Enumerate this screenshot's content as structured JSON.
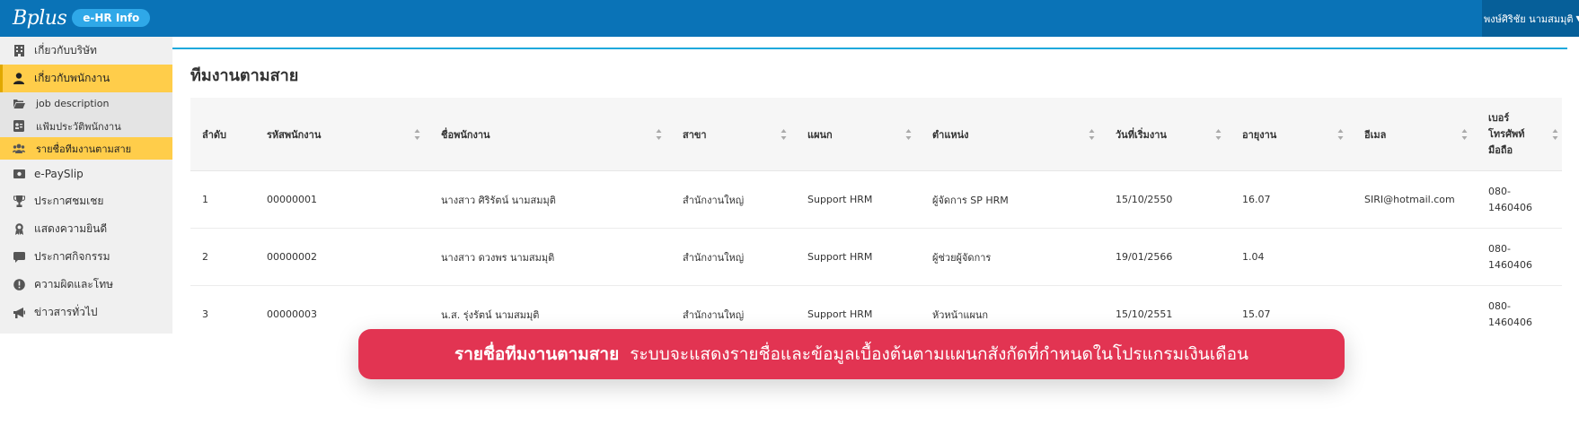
{
  "header": {
    "logo_text": "Bplus",
    "badge": "e-HR Info",
    "user_name": "พงษ์ศิริชัย นามสมมุติ"
  },
  "sidebar": {
    "items": [
      {
        "label": "เกี่ยวกับบริษัท",
        "icon": "building-icon"
      },
      {
        "label": "เกี่ยวกับพนักงาน",
        "icon": "user-icon",
        "active": true
      },
      {
        "label": "job description",
        "icon": "folder-open-icon",
        "sub": true
      },
      {
        "label": "แฟ้มประวัติพนักงาน",
        "icon": "id-card-icon",
        "sub": true
      },
      {
        "label": "รายชื่อทีมงานตามสาย",
        "icon": "users-icon",
        "sub": true,
        "active": true
      },
      {
        "label": "e-PaySlip",
        "icon": "money-icon"
      },
      {
        "label": "ประกาศชมเชย",
        "icon": "trophy-icon"
      },
      {
        "label": "แสดงความยินดี",
        "icon": "award-icon"
      },
      {
        "label": "ประกาศกิจกรรม",
        "icon": "comment-icon"
      },
      {
        "label": "ความผิดและโทษ",
        "icon": "exclamation-circle-icon"
      },
      {
        "label": "ข่าวสารทั่วไป",
        "icon": "megaphone-icon"
      }
    ]
  },
  "main": {
    "title": "ทีมงานตามสาย",
    "table": {
      "columns": [
        "ลำดับ",
        "รหัสพนักงาน",
        "ชื่อพนักงาน",
        "สาขา",
        "แผนก",
        "ตำแหน่ง",
        "วันที่เริ่มงาน",
        "อายุงาน",
        "อีเมล",
        "เบอร์\nโทรศัพท์\nมือถือ"
      ],
      "rows": [
        [
          "1",
          "00000001",
          "นางสาว ศิริรัตน์ นามสมมุติ",
          "สำนักงานใหญ่",
          "Support HRM",
          "ผู้จัดการ SP HRM",
          "15/10/2550",
          "16.07",
          "SIRI@hotmail.com",
          "080-\n1460406"
        ],
        [
          "2",
          "00000002",
          "นางสาว ดวงพร นามสมมุติ",
          "สำนักงานใหญ่",
          "Support HRM",
          "ผู้ช่วยผู้จัดการ",
          "19/01/2566",
          "1.04",
          "",
          "080-\n1460406"
        ],
        [
          "3",
          "00000003",
          "น.ส. รุ่งรัตน์ นามสมมุติ",
          "สำนักงานใหญ่",
          "Support HRM",
          "หัวหน้าแผนก",
          "15/10/2551",
          "15.07",
          "",
          "080-\n1460406"
        ]
      ]
    }
  },
  "caption": {
    "title": "รายชื่อทีมงานตามสาย",
    "text": "ระบบจะแสดงรายชื่อและข้อมูลเบื้องต้นตามแผนกสังกัดที่กำหนดในโปรแกรมเงินเดือน"
  },
  "colors": {
    "header_bg": "#0a73b7",
    "accent_yellow": "#ffcd4a",
    "caption_bg": "#e23452",
    "card_top_border": "#1ea9dc"
  }
}
